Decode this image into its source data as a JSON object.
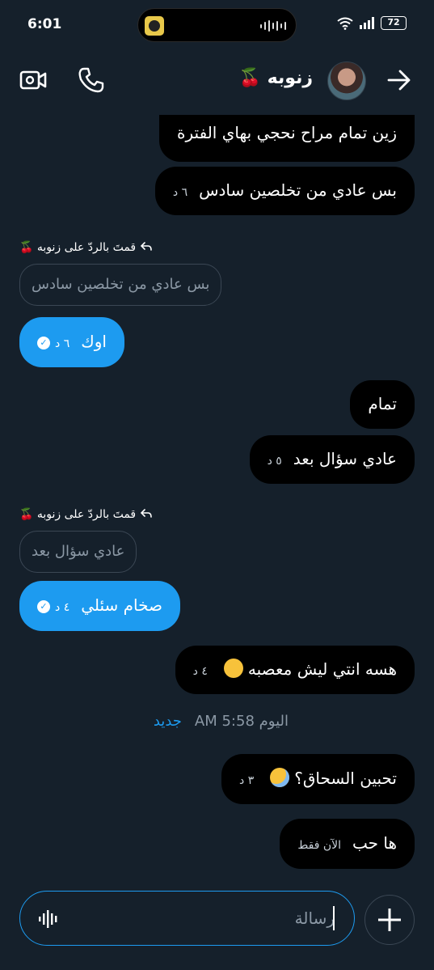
{
  "status_bar": {
    "time": "6:01",
    "battery": "72"
  },
  "header": {
    "contact_name": "زنوبه 🍒"
  },
  "messages": {
    "m1": {
      "text": "زين تمام مراح نحجي بهاي الفترة"
    },
    "m2": {
      "text": "بس عادي من تخلصين سادس",
      "time": "٦ د"
    },
    "reply1": {
      "label": "قمتَ بالردّ على زنوبه 🍒",
      "quote": "بس عادي من تخلصين سادس"
    },
    "m3": {
      "text": "اوك",
      "time": "٦ د"
    },
    "m4": {
      "text": "تمام"
    },
    "m5": {
      "text": "عادي سؤال بعد",
      "time": "٥ د"
    },
    "reply2": {
      "label": "قمتَ بالردّ على زنوبه 🍒",
      "quote": "عادي سؤال بعد"
    },
    "m6": {
      "text": "صخام سئلي",
      "time": "٤ د"
    },
    "m7": {
      "text": "هسه انتي ليش معصبه",
      "time": "٤ د"
    },
    "divider": {
      "text": "اليوم AM 5:58",
      "new_label": "جديد"
    },
    "m8": {
      "text": "تحبين السحاق؟",
      "time": "٣ د"
    },
    "m9": {
      "text": "ها حب",
      "time": "الآن فقط"
    }
  },
  "composer": {
    "placeholder": "رسالة"
  },
  "colors": {
    "background": "#15202b",
    "accent": "#1d9bf0",
    "incoming_bubble": "#000000"
  },
  "icons": [
    "video-call-icon",
    "phone-icon",
    "back-arrow-icon",
    "voice-icon",
    "plus-icon",
    "wifi-icon",
    "signal-icon",
    "check-icon",
    "reply-icon"
  ]
}
